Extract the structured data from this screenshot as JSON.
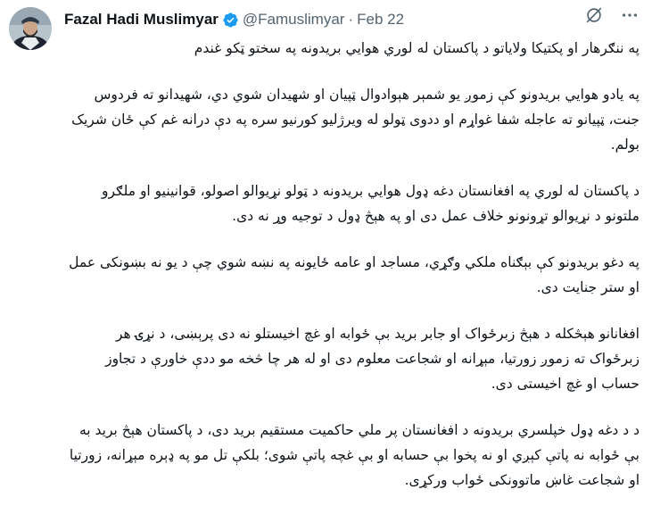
{
  "author": {
    "display_name": "Fazal Hadi Muslimyar",
    "handle": "@Famuslimyar",
    "separator": "·",
    "date": "Feb 22",
    "avatar_icon": "user-avatar-photo",
    "verified_icon": "verified-badge-icon"
  },
  "actions": {
    "grok_icon": "grok-icon",
    "more_icon": "more-options-icon"
  },
  "colors": {
    "text": "#0f1419",
    "secondary": "#536471",
    "verified": "#1d9bf0"
  },
  "paragraphs": [
    "په ننګرهار او پکتیکا ولایاتو د پاکستان له لوري هوايي بریدونه په سختو ټکو غندم",
    "په یادو هوايي بریدونو کې زموږ یو شمېر هېوادوال ټپیان او شهیدان شوي دي، شهیدانو ته فردوس جنت، ټپیانو ته عاجله شفا غواړم او ددوی ټولو له ویرژلیو کورنیو سره په دې درانه غم کې ځان شریک بولم.",
    "د پاکستان له لوري په افغانستان دغه ډول هوايي بریدونه د ټولو نړیوالو اصولو، قوانینیو او ملګرو ملتونو د نړیوالو تړونونو خلاف عمل دی او په هېڅ ډول د توجیه وړ نه دی.",
    "په دغو بریدونو کې بېګناه ملکي وګړي، مساجد او عامه ځایونه په نښه شوي چې د یو نه بښونکی عمل او ستر جنایت دی.",
    "افغانانو هېڅکله د هېڅ زبرځواک او جابر برید بې ځوابه او غچ اخیستلو نه دی پرېښی، د نړۍ هر زبرځواک ته زموږ زورتیا، مېړانه او شجاعت معلوم دی او له هر چا څخه مو ددې خاورې د تجاوز حساب او غچ اخیستی دی.",
    "د د دغه ډول خپلسري بریدونه د افغانستان پر ملي حاکمیت مستقیم برید دی، د پاکستان هېڅ برید به بې ځوابه نه پاتې کېږي او نه پخوا بې حسابه او بې غچه پاتې شوی؛ بلکې تل مو په ډېره مېړانه، زورتیا او شجاعت غاښ ماتوونکی ځواب ورکړی."
  ]
}
